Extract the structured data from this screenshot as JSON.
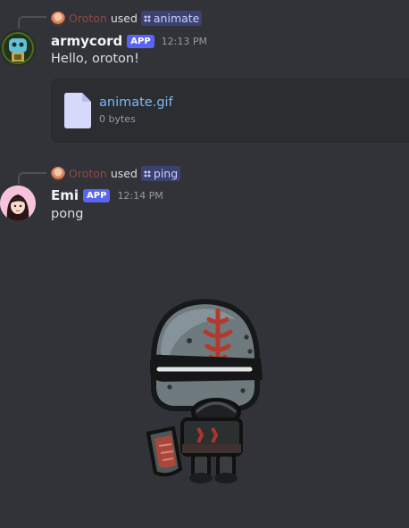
{
  "messages": [
    {
      "reply": {
        "user": "Oroton",
        "used": "used",
        "command": "animate"
      },
      "author": "armycord",
      "badge": "APP",
      "time": "12:13 PM",
      "text": "Hello, oroton!",
      "attachment": {
        "name": "animate.gif",
        "size": "0 bytes"
      }
    },
    {
      "reply": {
        "user": "Oroton",
        "used": "used",
        "command": "ping"
      },
      "author": "Emi",
      "badge": "APP",
      "time": "12:14 PM",
      "text": "pong"
    }
  ],
  "colors": {
    "background": "#313338",
    "app_badge": "#5865f2",
    "link": "#7cb8f5",
    "command_chip": "#3c4270"
  },
  "icons": [
    "command-icon",
    "file-icon",
    "sticker-knight"
  ]
}
